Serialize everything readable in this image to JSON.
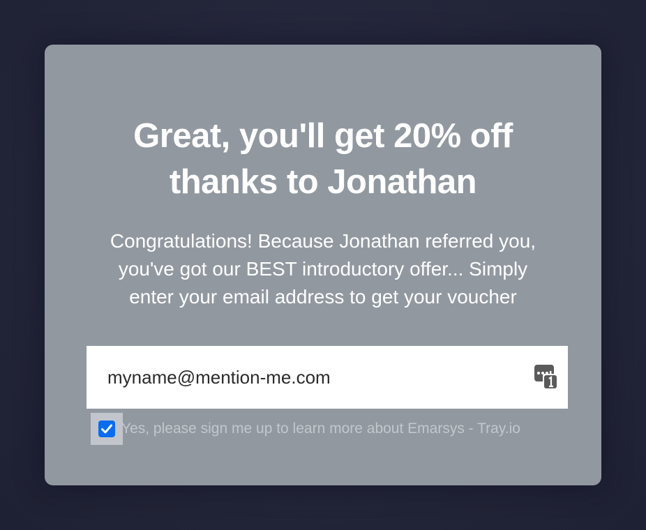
{
  "modal": {
    "headline": [
      "Great, you'll get 20% off",
      "thanks to Jonathan"
    ],
    "body": [
      "Congratulations! Because Jonathan referred you,",
      "you've got our BEST introductory offer... Simply",
      "enter your email address to get your voucher"
    ],
    "email": {
      "value": "myname@mention-me.com",
      "icon": "password-manager-icon"
    },
    "consent": {
      "checked": true,
      "label": "Yes, please sign me up to learn more about Emarsys - Tray.io"
    }
  },
  "colors": {
    "background": "#232539",
    "card": "#9198a0",
    "checkbox": "#0a6cf0",
    "text": "#ffffff"
  }
}
